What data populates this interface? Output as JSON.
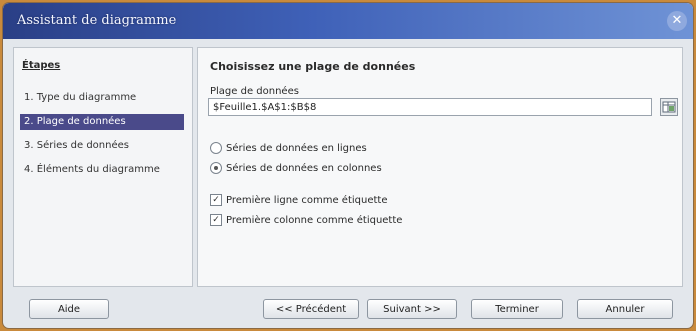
{
  "window": {
    "title": "Assistant de diagramme",
    "close_glyph": "✕"
  },
  "sidebar": {
    "title": "Étapes",
    "steps": [
      {
        "label": "1. Type du diagramme",
        "selected": false
      },
      {
        "label": "2. Plage de données",
        "selected": true
      },
      {
        "label": "3. Séries de données",
        "selected": false
      },
      {
        "label": "4. Éléments du diagramme",
        "selected": false
      }
    ]
  },
  "main": {
    "heading": "Choisissez une plage de données",
    "range_label": "Plage de données",
    "range_value": "$Feuille1.$A$1:$B$8",
    "options": {
      "series_rows": {
        "label": "Séries de données en lignes",
        "selected": false
      },
      "series_columns": {
        "label": "Séries de données en colonnes",
        "selected": true
      },
      "first_row_label": {
        "label": "Première ligne comme étiquette",
        "checked": true
      },
      "first_col_label": {
        "label": "Première colonne comme étiquette",
        "checked": true
      }
    }
  },
  "footer": {
    "help": "Aide",
    "previous": "<< Précédent",
    "next": "Suivant >>",
    "finish": "Terminer",
    "cancel": "Annuler"
  },
  "icons": {
    "close": "close-icon",
    "range_picker": "range-select-icon",
    "checkmark": "checkmark-icon"
  },
  "colors": {
    "titlebar_dark": "#2a3f86",
    "titlebar_light": "#6f93d6",
    "selected_step": "#4a4a8a",
    "outer_background": "#c98a3c"
  }
}
